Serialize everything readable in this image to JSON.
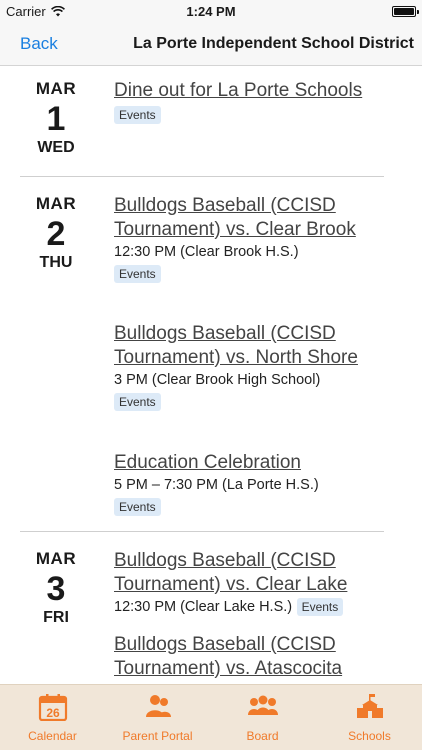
{
  "status": {
    "carrier": "Carrier",
    "time": "1:24 PM",
    "battery_level": 1.0
  },
  "nav": {
    "back_label": "Back",
    "title": "La Porte Independent School District"
  },
  "days": [
    {
      "month": "MAR",
      "day": "1",
      "weekday": "WED",
      "events": [
        {
          "title": "Dine out for La Porte Schools",
          "time": "",
          "tag": "Events"
        }
      ]
    },
    {
      "month": "MAR",
      "day": "2",
      "weekday": "THU",
      "events": [
        {
          "title": "Bulldogs Baseball (CCISD Tournament) vs. Clear Brook",
          "time": "12:30 PM (Clear Brook H.S.)",
          "tag": "Events"
        },
        {
          "title": "Bulldogs Baseball (CCISD Tournament) vs. North Shore",
          "time": "3 PM (Clear Brook High School)",
          "tag": "Events"
        },
        {
          "title": "Education Celebration",
          "time": "5 PM  –  7:30 PM (La Porte H.S.)",
          "tag": "Events"
        }
      ]
    },
    {
      "month": "MAR",
      "day": "3",
      "weekday": "FRI",
      "events": [
        {
          "title": "Bulldogs Baseball (CCISD Tournament) vs. Clear Lake",
          "time": "12:30 PM (Clear Lake H.S.)",
          "tag": "Events"
        },
        {
          "title": "Bulldogs Baseball (CCISD Tournament) vs. Atascocita",
          "time": "",
          "tag": ""
        }
      ]
    }
  ],
  "tabs": [
    {
      "label": "Calendar",
      "icon": "calendar-icon",
      "badge": "26"
    },
    {
      "label": "Parent Portal",
      "icon": "parent-portal-icon"
    },
    {
      "label": "Board",
      "icon": "board-icon"
    },
    {
      "label": "Schools",
      "icon": "schools-icon"
    }
  ],
  "colors": {
    "accent": "#f07a2a",
    "link": "#1a7fe0",
    "tag_bg": "#ddeaf7",
    "tab_bg": "#f1e6d8"
  }
}
